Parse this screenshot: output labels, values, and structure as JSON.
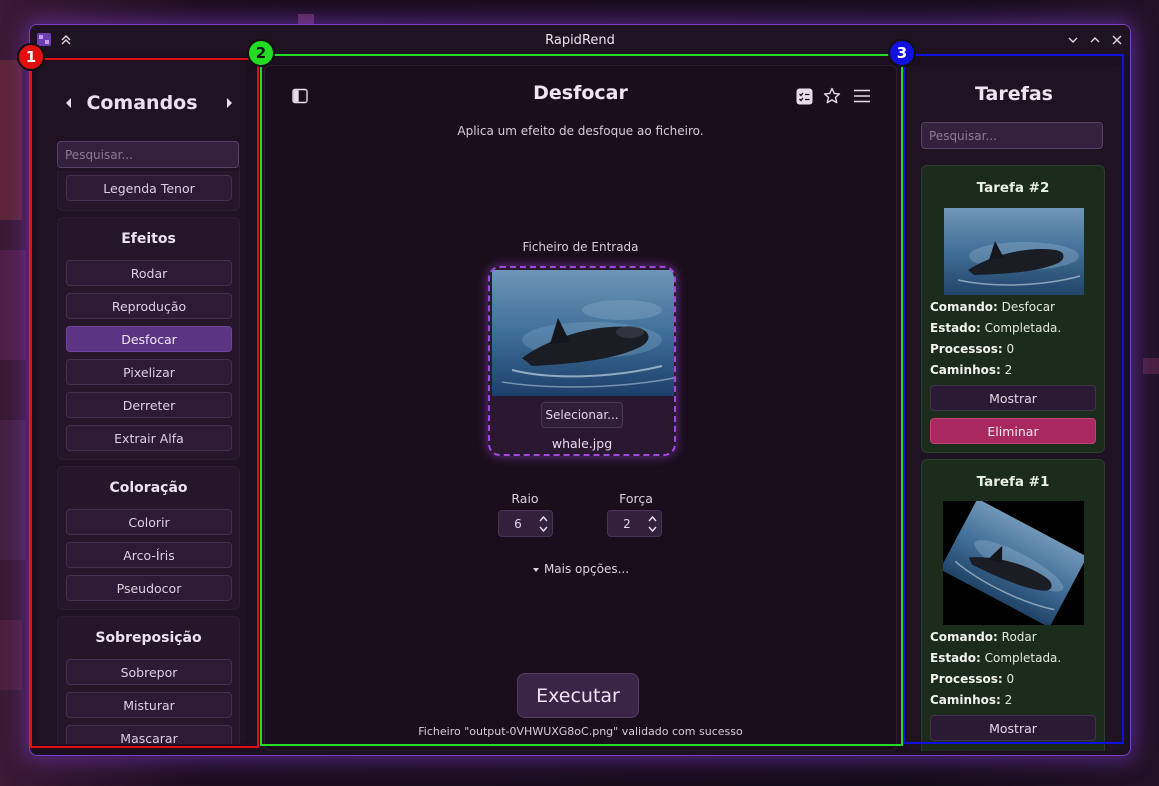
{
  "window": {
    "title": "RapidRend"
  },
  "sidebar": {
    "heading": "Comandos",
    "search_placeholder": "Pesquisar...",
    "groups": [
      {
        "title": "",
        "items": [
          "Legenda Tenor"
        ]
      },
      {
        "title": "Efeitos",
        "items": [
          "Rodar",
          "Reprodução",
          "Desfocar",
          "Pixelizar",
          "Derreter",
          "Extrair Alfa"
        ]
      },
      {
        "title": "Coloração",
        "items": [
          "Colorir",
          "Arco-Íris",
          "Pseudocor"
        ]
      },
      {
        "title": "Sobreposição",
        "items": [
          "Sobrepor",
          "Misturar",
          "Mascarar"
        ]
      }
    ],
    "active_item": "Desfocar"
  },
  "main": {
    "title": "Desfocar",
    "description": "Aplica um efeito de desfoque ao ficheiro.",
    "input_label": "Ficheiro de Entrada",
    "select_button": "Selecionar...",
    "file_name": "whale.jpg",
    "params": [
      {
        "label": "Raio",
        "value": "6"
      },
      {
        "label": "Força",
        "value": "2"
      }
    ],
    "more_options": "Mais opções...",
    "execute_button": "Executar",
    "status": "Ficheiro \"output-0VHWUXG8oC.png\" validado com sucesso"
  },
  "tasks": {
    "heading": "Tarefas",
    "search_placeholder": "Pesquisar...",
    "items": [
      {
        "title": "Tarefa #2",
        "command_label": "Comando:",
        "command": "Desfocar",
        "state_label": "Estado:",
        "state": "Completada.",
        "processes_label": "Processos:",
        "processes": "0",
        "paths_label": "Caminhos:",
        "paths": "2",
        "show_button": "Mostrar",
        "delete_button": "Eliminar"
      },
      {
        "title": "Tarefa #1",
        "command_label": "Comando:",
        "command": "Rodar",
        "state_label": "Estado:",
        "state": "Completada.",
        "processes_label": "Processos:",
        "processes": "0",
        "paths_label": "Caminhos:",
        "paths": "2",
        "show_button": "Mostrar"
      }
    ]
  },
  "annotations": [
    "1",
    "2",
    "3"
  ],
  "colors": {
    "accent": "#5b3483",
    "danger": "#a9285f",
    "task_card": "#1b2b1c",
    "anno_red": "#e01010",
    "anno_green": "#22dd22",
    "anno_blue": "#1010e0"
  }
}
